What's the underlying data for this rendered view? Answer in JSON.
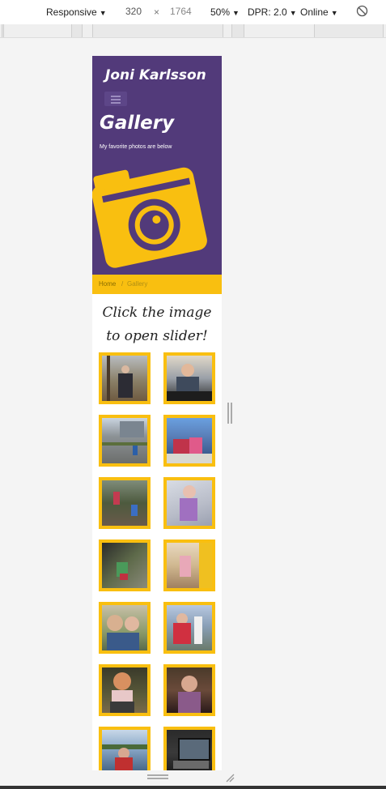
{
  "devtools": {
    "device_mode": "Responsive",
    "width": "320",
    "times": "×",
    "height": "1764",
    "zoom": "50%",
    "dpr": "DPR: 2.0",
    "network": "Online",
    "rotate_icon": "rotate-icon"
  },
  "site": {
    "title": "Joni Karlsson",
    "menu_icon": "hamburger-menu-icon"
  },
  "hero": {
    "page_title": "Gallery",
    "subtitle": "My favorite photos are below",
    "camera_icon": "camera-icon",
    "colors": {
      "background": "#523a7a",
      "accent": "#f9bf10"
    }
  },
  "breadcrumb": {
    "home": "Home",
    "separator": "/",
    "current": "Gallery"
  },
  "gallery": {
    "instruction_line1": "Click the image",
    "instruction_line2": "to open slider!",
    "photo_count_visible": 14
  }
}
